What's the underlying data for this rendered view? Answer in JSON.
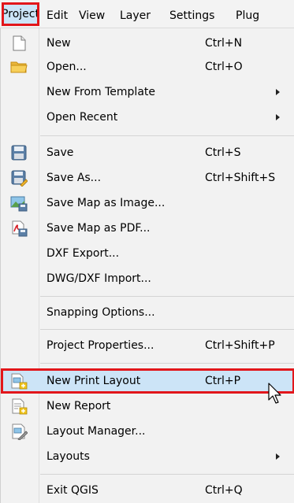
{
  "menubar": {
    "items": [
      "Project",
      "Edit",
      "View",
      "Layer",
      "Settings",
      "Plug"
    ]
  },
  "menu": {
    "new": {
      "label": "New",
      "shortcut": "Ctrl+N",
      "icon": "new-file-icon"
    },
    "open": {
      "label": "Open...",
      "shortcut": "Ctrl+O",
      "icon": "folder-icon"
    },
    "new_from_template": {
      "label": "New From Template",
      "submenu": true
    },
    "open_recent": {
      "label": "Open Recent",
      "submenu": true
    },
    "save": {
      "label": "Save",
      "shortcut": "Ctrl+S",
      "icon": "save-icon"
    },
    "save_as": {
      "label": "Save As...",
      "shortcut": "Ctrl+Shift+S",
      "icon": "save-as-icon"
    },
    "save_map_image": {
      "label": "Save Map as Image...",
      "icon": "save-image-icon"
    },
    "save_map_pdf": {
      "label": "Save Map as PDF...",
      "icon": "pdf-icon"
    },
    "dxf_export": {
      "label": "DXF Export..."
    },
    "dwg_import": {
      "label": "DWG/DXF Import..."
    },
    "snapping": {
      "label": "Snapping Options..."
    },
    "properties": {
      "label": "Project Properties...",
      "shortcut": "Ctrl+Shift+P"
    },
    "new_print_layout": {
      "label": "New Print Layout",
      "shortcut": "Ctrl+P",
      "icon": "new-print-layout-icon",
      "highlighted": true
    },
    "new_report": {
      "label": "New Report",
      "icon": "new-report-icon"
    },
    "layout_manager": {
      "label": "Layout Manager...",
      "icon": "layout-manager-icon"
    },
    "layouts": {
      "label": "Layouts",
      "submenu": true
    },
    "exit": {
      "label": "Exit QGIS",
      "shortcut": "Ctrl+Q"
    }
  },
  "colors": {
    "highlight_fill": "#cce4f7",
    "highlight_outline": "#e2161b",
    "menu_background": "#f2f2f2"
  }
}
